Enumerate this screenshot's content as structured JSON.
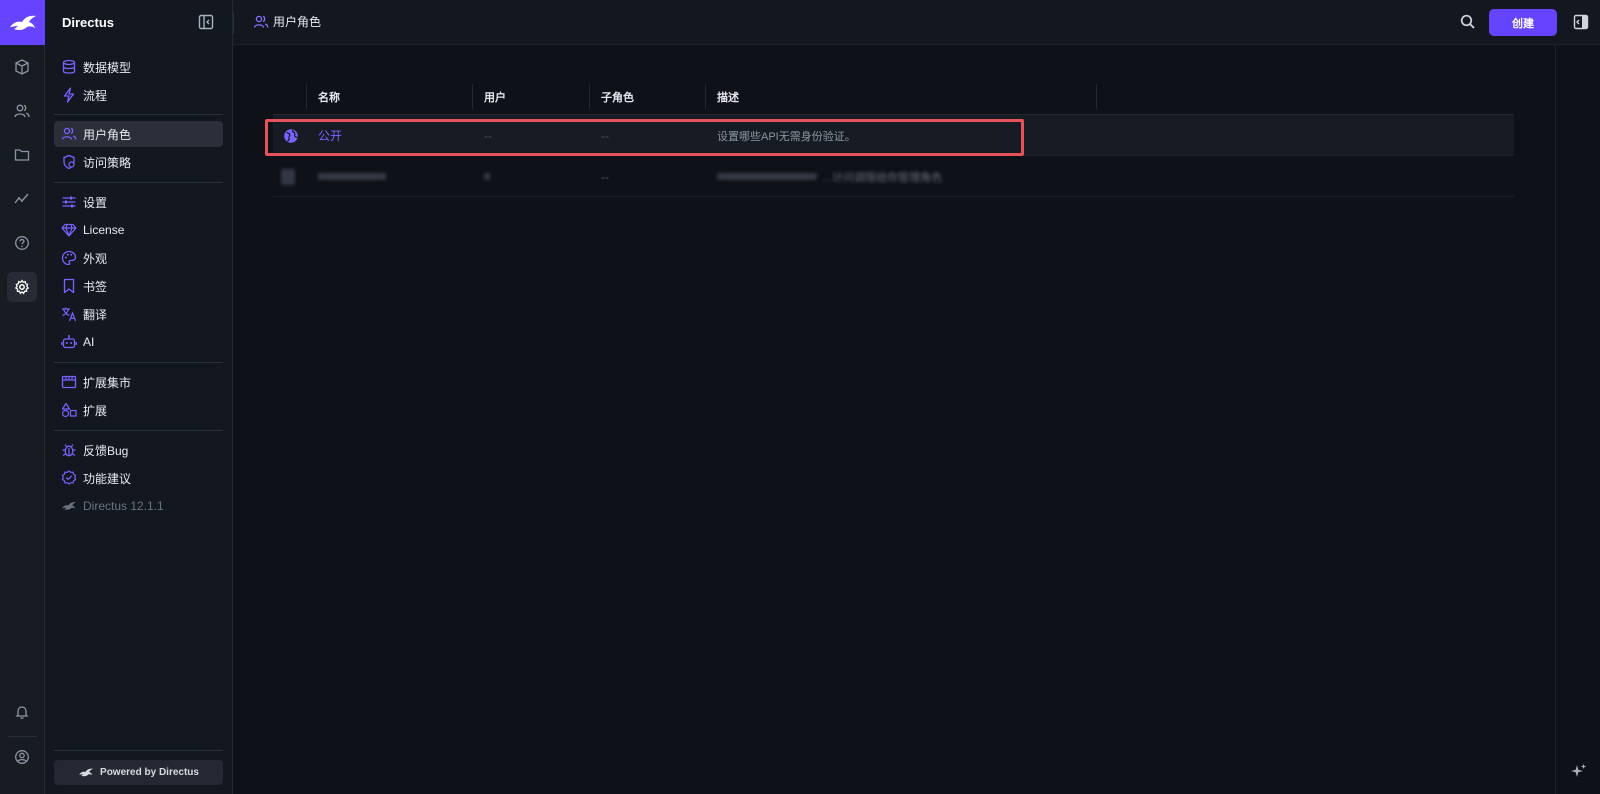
{
  "app": {
    "title": "Directus"
  },
  "header": {
    "breadcrumb": "用户角色",
    "create_label": "创建"
  },
  "nav": {
    "items": [
      {
        "label": "数据模型",
        "icon": "database-icon"
      },
      {
        "label": "流程",
        "icon": "bolt-icon"
      },
      {
        "label": "用户角色",
        "icon": "users-icon",
        "active": true
      },
      {
        "label": "访问策略",
        "icon": "policy-icon"
      },
      {
        "label": "设置",
        "icon": "sliders-icon"
      },
      {
        "label": "License",
        "icon": "diamond-icon"
      },
      {
        "label": "外观",
        "icon": "palette-icon"
      },
      {
        "label": "书签",
        "icon": "bookmark-icon"
      },
      {
        "label": "翻译",
        "icon": "translate-icon"
      },
      {
        "label": "AI",
        "icon": "robot-icon"
      },
      {
        "label": "扩展集市",
        "icon": "storefront-icon"
      },
      {
        "label": "扩展",
        "icon": "extension-icon"
      },
      {
        "label": "反馈Bug",
        "icon": "bug-icon"
      },
      {
        "label": "功能建议",
        "icon": "verified-icon"
      },
      {
        "label": "Directus 12.1.1",
        "icon": "directus-icon"
      }
    ],
    "powered_by": "Powered by Directus"
  },
  "table": {
    "headers": [
      "名称",
      "用户",
      "子角色",
      "描述"
    ],
    "rows": [
      {
        "name": "公开",
        "users": "--",
        "children": "--",
        "description": "设置哪些API无需身份验证。"
      },
      {
        "name": "",
        "users": "",
        "children": "--",
        "description": "...计问调限给你管理角色"
      }
    ]
  },
  "colors": {
    "accent": "#6644ff",
    "highlight_border": "#e8525a"
  }
}
